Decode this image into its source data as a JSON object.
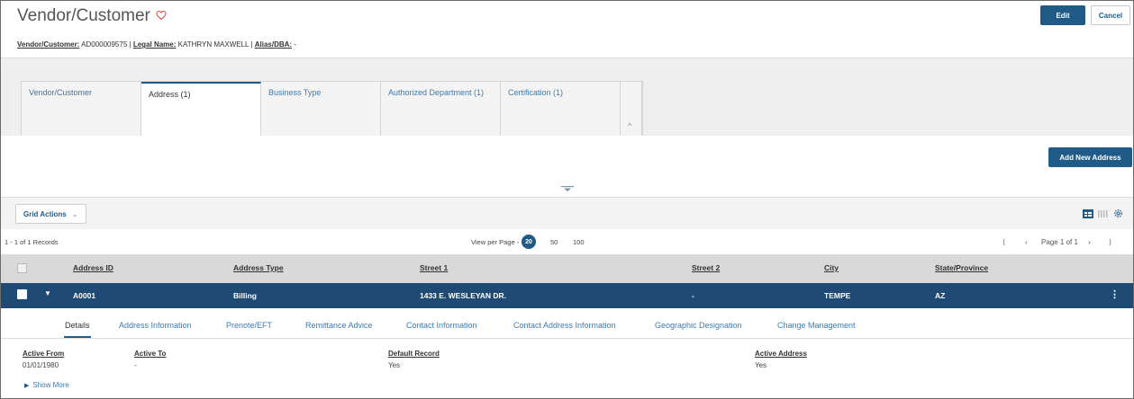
{
  "header": {
    "title": "Vendor/Customer",
    "subtitle": {
      "vendor_label": "Vendor/Customer:",
      "vendor_value": "AD000009575",
      "sep1": "|",
      "legal_label": "Legal Name:",
      "legal_value": "KATHRYN MAXWELL",
      "sep2": "|",
      "alias_label": "Alias/DBA:",
      "alias_value": "-"
    },
    "edit_label": "Edit",
    "cancel_label": "Cancel"
  },
  "tabs": [
    {
      "label": "Vendor/Customer"
    },
    {
      "label": "Address (1)"
    },
    {
      "label": "Business Type"
    },
    {
      "label": "Authorized Department (1)"
    },
    {
      "label": "Certification (1)"
    }
  ],
  "collapse_icon": "^",
  "add_new_address_label": "Add New Address",
  "grid": {
    "actions_label": "Grid Actions",
    "records_text": "1 - 1 of 1 Records",
    "view_per_page_label": "View per Page -",
    "page_sizes": [
      "20",
      "50",
      "100"
    ],
    "selected_page_size": "20",
    "page_label": "Page 1 of 1",
    "columns": [
      "Address ID",
      "Address Type",
      "Street 1",
      "Street 2",
      "City",
      "State/Province"
    ],
    "rows": [
      {
        "address_id": "A0001",
        "address_type": "Billing",
        "street1": "1433 E. WESLEYAN DR.",
        "street2": "-",
        "city": "TEMPE",
        "state": "AZ"
      }
    ]
  },
  "detail_tabs": [
    "Details",
    "Address Information",
    "Prenote/EFT",
    "Remittance Advice",
    "Contact Information",
    "Contact Address Information",
    "Geographic Designation",
    "Change Management"
  ],
  "details": {
    "active_from_label": "Active From",
    "active_from_value": "01/01/1980",
    "active_to_label": "Active To",
    "active_to_value": "-",
    "default_record_label": "Default Record",
    "default_record_value": "Yes",
    "active_address_label": "Active Address",
    "active_address_value": "Yes",
    "show_more_label": "Show More"
  },
  "colors": {
    "primary": "#1f5b86",
    "selected_row": "#1f4a73",
    "link": "#3d7ab0"
  }
}
